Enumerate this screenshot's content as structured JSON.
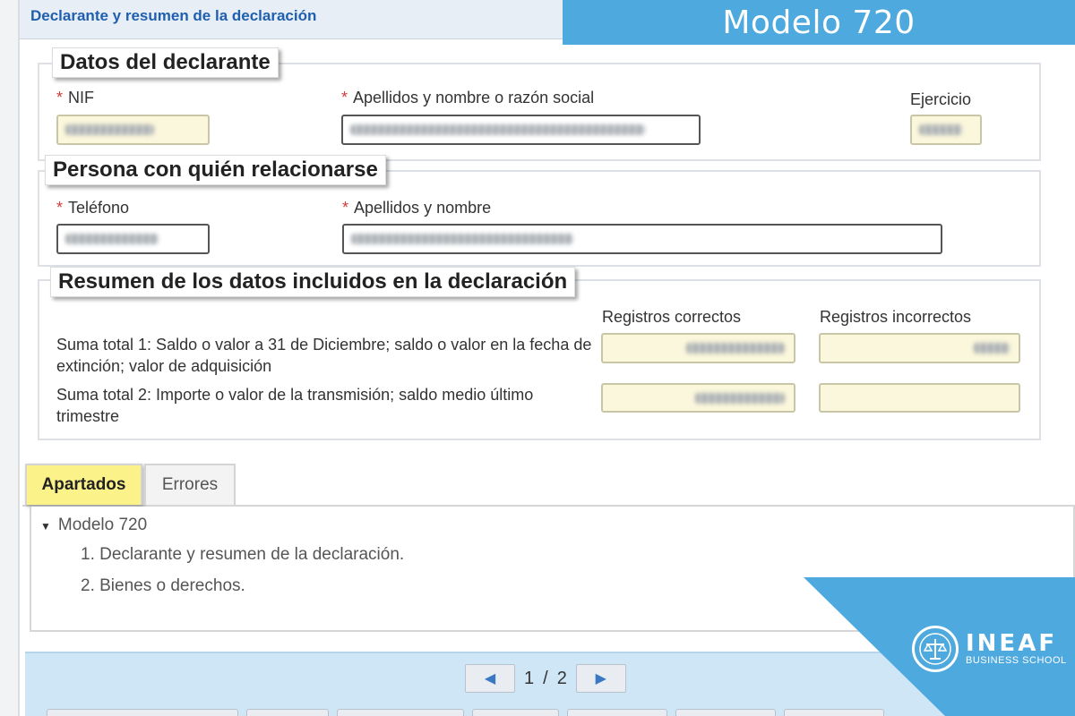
{
  "header": {
    "title": "Declarante y resumen de la declaración"
  },
  "banner": {
    "text": "Modelo 720"
  },
  "declarante": {
    "legend": "Datos del declarante",
    "nif_label": "NIF",
    "nombre_label": "Apellidos y nombre o razón social",
    "ejercicio_label": "Ejercicio"
  },
  "contacto": {
    "legend": "Persona con quién relacionarse",
    "telefono_label": "Teléfono",
    "nombre_label": "Apellidos y nombre"
  },
  "resumen": {
    "legend": "Resumen de los datos incluidos en la declaración",
    "col_correctos": "Registros correctos",
    "col_incorrectos": "Registros incorrectos",
    "suma1_desc": "Suma total 1: Saldo o valor a 31 de Diciembre; saldo o valor en la fecha de extinción; valor de adquisición",
    "suma2_desc": "Suma total 2: Importe o valor de la transmisión; saldo medio último trimestre"
  },
  "tabs": [
    {
      "label": "Apartados",
      "active": true
    },
    {
      "label": "Errores",
      "active": false
    }
  ],
  "tree": {
    "root": "Modelo 720",
    "items": [
      "1. Declarante y resumen de la declaración.",
      "2. Bienes o derechos."
    ]
  },
  "pager": {
    "current": "1",
    "separator": "/",
    "total": "2"
  },
  "logo": {
    "name": "INEAF",
    "subtitle": "BUSINESS SCHOOL"
  },
  "colors": {
    "accent": "#4ea9de",
    "header_text": "#1f5fae",
    "active_tab": "#fbf28a",
    "field_yellow": "#fbf7dc"
  }
}
